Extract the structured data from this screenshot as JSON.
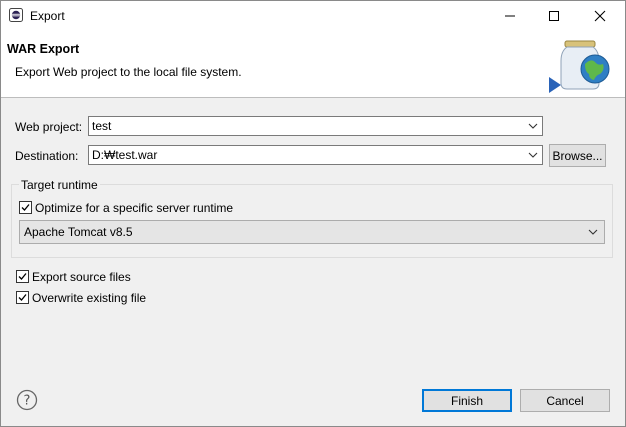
{
  "window": {
    "title": "Export",
    "icons": {
      "app": "eclipse-app-icon",
      "minimize": "minimize-icon",
      "maximize": "maximize-icon",
      "close": "close-icon"
    }
  },
  "header": {
    "title": "WAR Export",
    "description": "Export Web project to the local file system.",
    "icon": "war-export-wizard-icon"
  },
  "form": {
    "web_project_label": "Web project:",
    "web_project_value": "test",
    "destination_label": "Destination:",
    "destination_value": "D:₩test.war",
    "browse_label": "Browse..."
  },
  "target_runtime": {
    "group_title": "Target runtime",
    "optimize_label": "Optimize for a specific server runtime",
    "optimize_checked": true,
    "runtime_selected": "Apache Tomcat v8.5"
  },
  "options": {
    "export_source_label": "Export source files",
    "export_source_checked": true,
    "overwrite_label": "Overwrite existing file",
    "overwrite_checked": true
  },
  "footer": {
    "help_icon": "help-icon",
    "finish_label": "Finish",
    "cancel_label": "Cancel"
  },
  "colors": {
    "accent": "#0078d7",
    "dialog_bg": "#f0f0f0",
    "header_bg": "#ffffff"
  }
}
